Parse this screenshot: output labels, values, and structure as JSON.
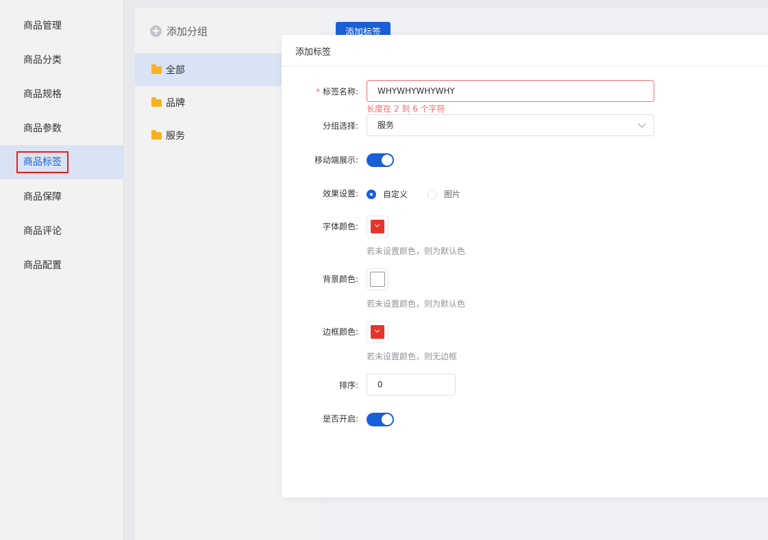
{
  "nav": {
    "items": [
      {
        "label": "商品管理"
      },
      {
        "label": "商品分类"
      },
      {
        "label": "商品规格"
      },
      {
        "label": "商品参数"
      },
      {
        "label": "商品标签"
      },
      {
        "label": "商品保障"
      },
      {
        "label": "商品评论"
      },
      {
        "label": "商品配置"
      }
    ],
    "active_index": 4
  },
  "groups": {
    "add_label": "添加分组",
    "items": [
      {
        "label": "全部"
      },
      {
        "label": "品牌"
      },
      {
        "label": "服务"
      }
    ],
    "active_index": 0
  },
  "main": {
    "add_tag_button": "添加标签"
  },
  "dialog": {
    "title": "添加标签",
    "fields": {
      "name": {
        "label": "标签名称:",
        "value": "WHYWHYWHYWHY",
        "error": "长度在 2 到 6 个字符",
        "required_mark": "*"
      },
      "group": {
        "label": "分组选择:",
        "value": "服务"
      },
      "mobile": {
        "label": "移动端展示:",
        "on": true
      },
      "effect": {
        "label": "效果设置:",
        "options": [
          "自定义",
          "图片"
        ],
        "selected": "自定义"
      },
      "font_color": {
        "label": "字体颜色:",
        "color": "#e5352b",
        "hint": "若未设置颜色，则为默认色"
      },
      "bg_color": {
        "label": "背景颜色:",
        "color": "",
        "hint": "若未设置颜色，则为默认色"
      },
      "border_color": {
        "label": "边框颜色:",
        "color": "#e5352b",
        "hint": "若未设置颜色，则无边框"
      },
      "sort": {
        "label": "排序:",
        "value": "0"
      },
      "enabled": {
        "label": "是否开启:",
        "on": true
      }
    }
  },
  "colors": {
    "primary": "#1a5fd6",
    "error": "#f56c6c",
    "highlight": "#e02020"
  }
}
